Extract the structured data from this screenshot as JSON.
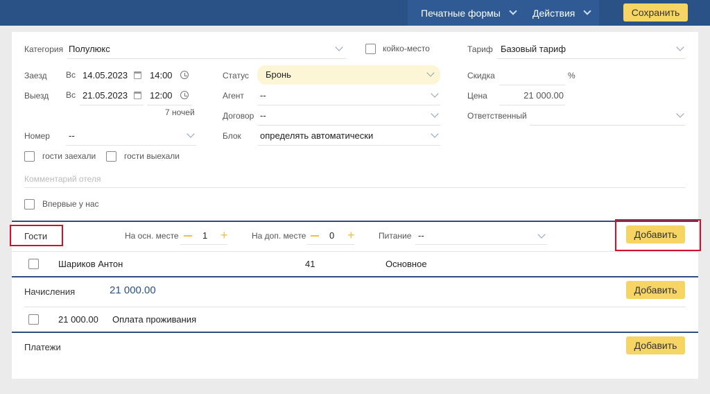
{
  "header": {
    "print_forms": "Печатные формы",
    "actions": "Действия",
    "save": "Сохранить"
  },
  "form": {
    "category": {
      "label": "Категория",
      "value": "Полулюкс"
    },
    "bed_place": {
      "label": "койко-место",
      "checked": false
    },
    "tariff": {
      "label": "Тариф",
      "value": "Базовый тариф"
    },
    "checkin": {
      "label": "Заезд",
      "weekday": "Вс",
      "date": "14.05.2023",
      "time": "14:00"
    },
    "checkout": {
      "label": "Выезд",
      "weekday": "Вс",
      "date": "21.05.2023",
      "time": "12:00"
    },
    "nights": "7 ночей",
    "status": {
      "label": "Статус",
      "value": "Бронь"
    },
    "agent": {
      "label": "Агент",
      "value": "--"
    },
    "contract": {
      "label": "Договор",
      "value": "--"
    },
    "block": {
      "label": "Блок",
      "value": "определять автоматически"
    },
    "discount": {
      "label": "Скидка",
      "value": "",
      "unit": "%"
    },
    "price": {
      "label": "Цена",
      "value": "21 000.00"
    },
    "responsible": {
      "label": "Ответственный",
      "value": ""
    },
    "room": {
      "label": "Номер",
      "value": "--"
    },
    "guests_checked_in": "гости заехали",
    "guests_checked_out": "гости выехали",
    "hotel_comment_placeholder": "Комментарий отеля",
    "first_time": "Впервые у нас"
  },
  "guests": {
    "title": "Гости",
    "main_place": {
      "label": "На осн. месте",
      "value": "1"
    },
    "extra_place": {
      "label": "На доп. месте",
      "value": "0"
    },
    "meals": {
      "label": "Питание",
      "value": "--"
    },
    "add": "Добавить",
    "rows": [
      {
        "name": "Шариков Антон",
        "number": "41",
        "place": "Основное"
      }
    ]
  },
  "charges": {
    "title": "Начисления",
    "total": "21 000.00",
    "add": "Добавить",
    "rows": [
      {
        "amount": "21 000.00",
        "description": "Оплата проживания"
      }
    ]
  },
  "payments": {
    "title": "Платежи",
    "add": "Добавить"
  }
}
